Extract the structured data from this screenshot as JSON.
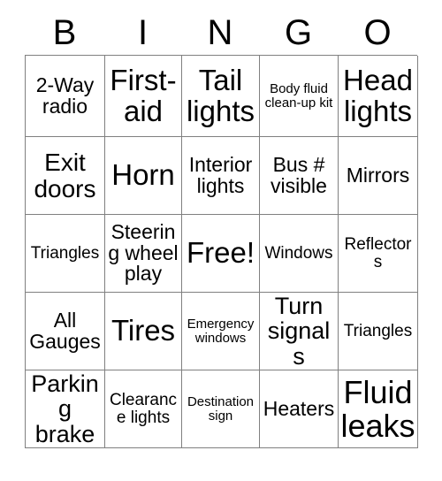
{
  "card": {
    "title": "Bingo Card",
    "header": {
      "letters": [
        "B",
        "I",
        "N",
        "G",
        "O"
      ]
    },
    "grid": {
      "rows": [
        [
          {
            "text": "2-Way radio",
            "size": "fs-m",
            "free": false
          },
          {
            "text": "First-aid",
            "size": "fs-xl",
            "free": false
          },
          {
            "text": "Tail lights",
            "size": "fs-xl",
            "free": false
          },
          {
            "text": "Body fluid clean-up kit",
            "size": "fs-xs",
            "free": false
          },
          {
            "text": "Head lights",
            "size": "fs-xl",
            "free": false
          }
        ],
        [
          {
            "text": "Exit doors",
            "size": "fs-l",
            "free": false
          },
          {
            "text": "Horn",
            "size": "fs-xl",
            "free": false
          },
          {
            "text": "Interior lights",
            "size": "fs-m",
            "free": false
          },
          {
            "text": "Bus # visible",
            "size": "fs-m",
            "free": false
          },
          {
            "text": "Mirrors",
            "size": "fs-m",
            "free": false
          }
        ],
        [
          {
            "text": "Triangles",
            "size": "fs-s",
            "free": false
          },
          {
            "text": "Steering wheel play",
            "size": "fs-m",
            "free": false
          },
          {
            "text": "Free!",
            "size": "fs-xl",
            "free": true
          },
          {
            "text": "Windows",
            "size": "fs-s",
            "free": false
          },
          {
            "text": "Reflectors",
            "size": "fs-s",
            "free": false
          }
        ],
        [
          {
            "text": "All Gauges",
            "size": "fs-m",
            "free": false
          },
          {
            "text": "Tires",
            "size": "fs-xl",
            "free": false
          },
          {
            "text": "Emergency windows",
            "size": "fs-xs",
            "free": false
          },
          {
            "text": "Turn signals",
            "size": "fs-l",
            "free": false
          },
          {
            "text": "Triangles",
            "size": "fs-s",
            "free": false
          }
        ],
        [
          {
            "text": "Parking brake",
            "size": "fs-l",
            "free": false
          },
          {
            "text": "Clearance lights",
            "size": "fs-s",
            "free": false
          },
          {
            "text": "Destination sign",
            "size": "fs-xs",
            "free": false
          },
          {
            "text": "Heaters",
            "size": "fs-m",
            "free": false
          },
          {
            "text": "Fluid leaks",
            "size": "fs-xxl",
            "free": false
          }
        ]
      ]
    },
    "colors": {
      "background": "#ffffff",
      "text": "#000000",
      "border": "#808080"
    }
  }
}
